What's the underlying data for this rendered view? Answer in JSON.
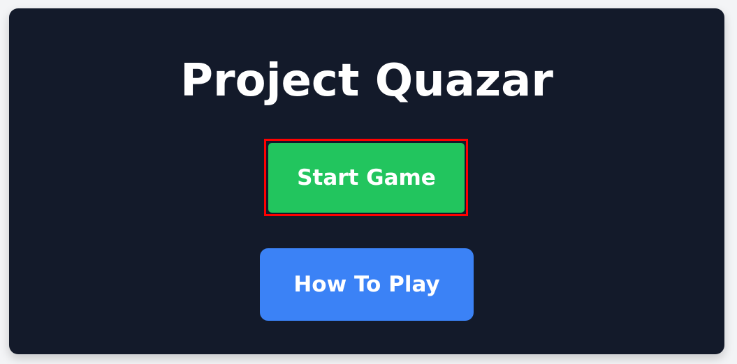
{
  "menu": {
    "title": "Project Quazar",
    "start_label": "Start Game",
    "how_to_play_label": "How To Play"
  },
  "colors": {
    "background": "#f3f4f6",
    "card": "#131a2a",
    "start_button": "#22c55e",
    "how_to_play_button": "#3b82f6",
    "highlight": "#ff0000",
    "text": "#ffffff"
  }
}
